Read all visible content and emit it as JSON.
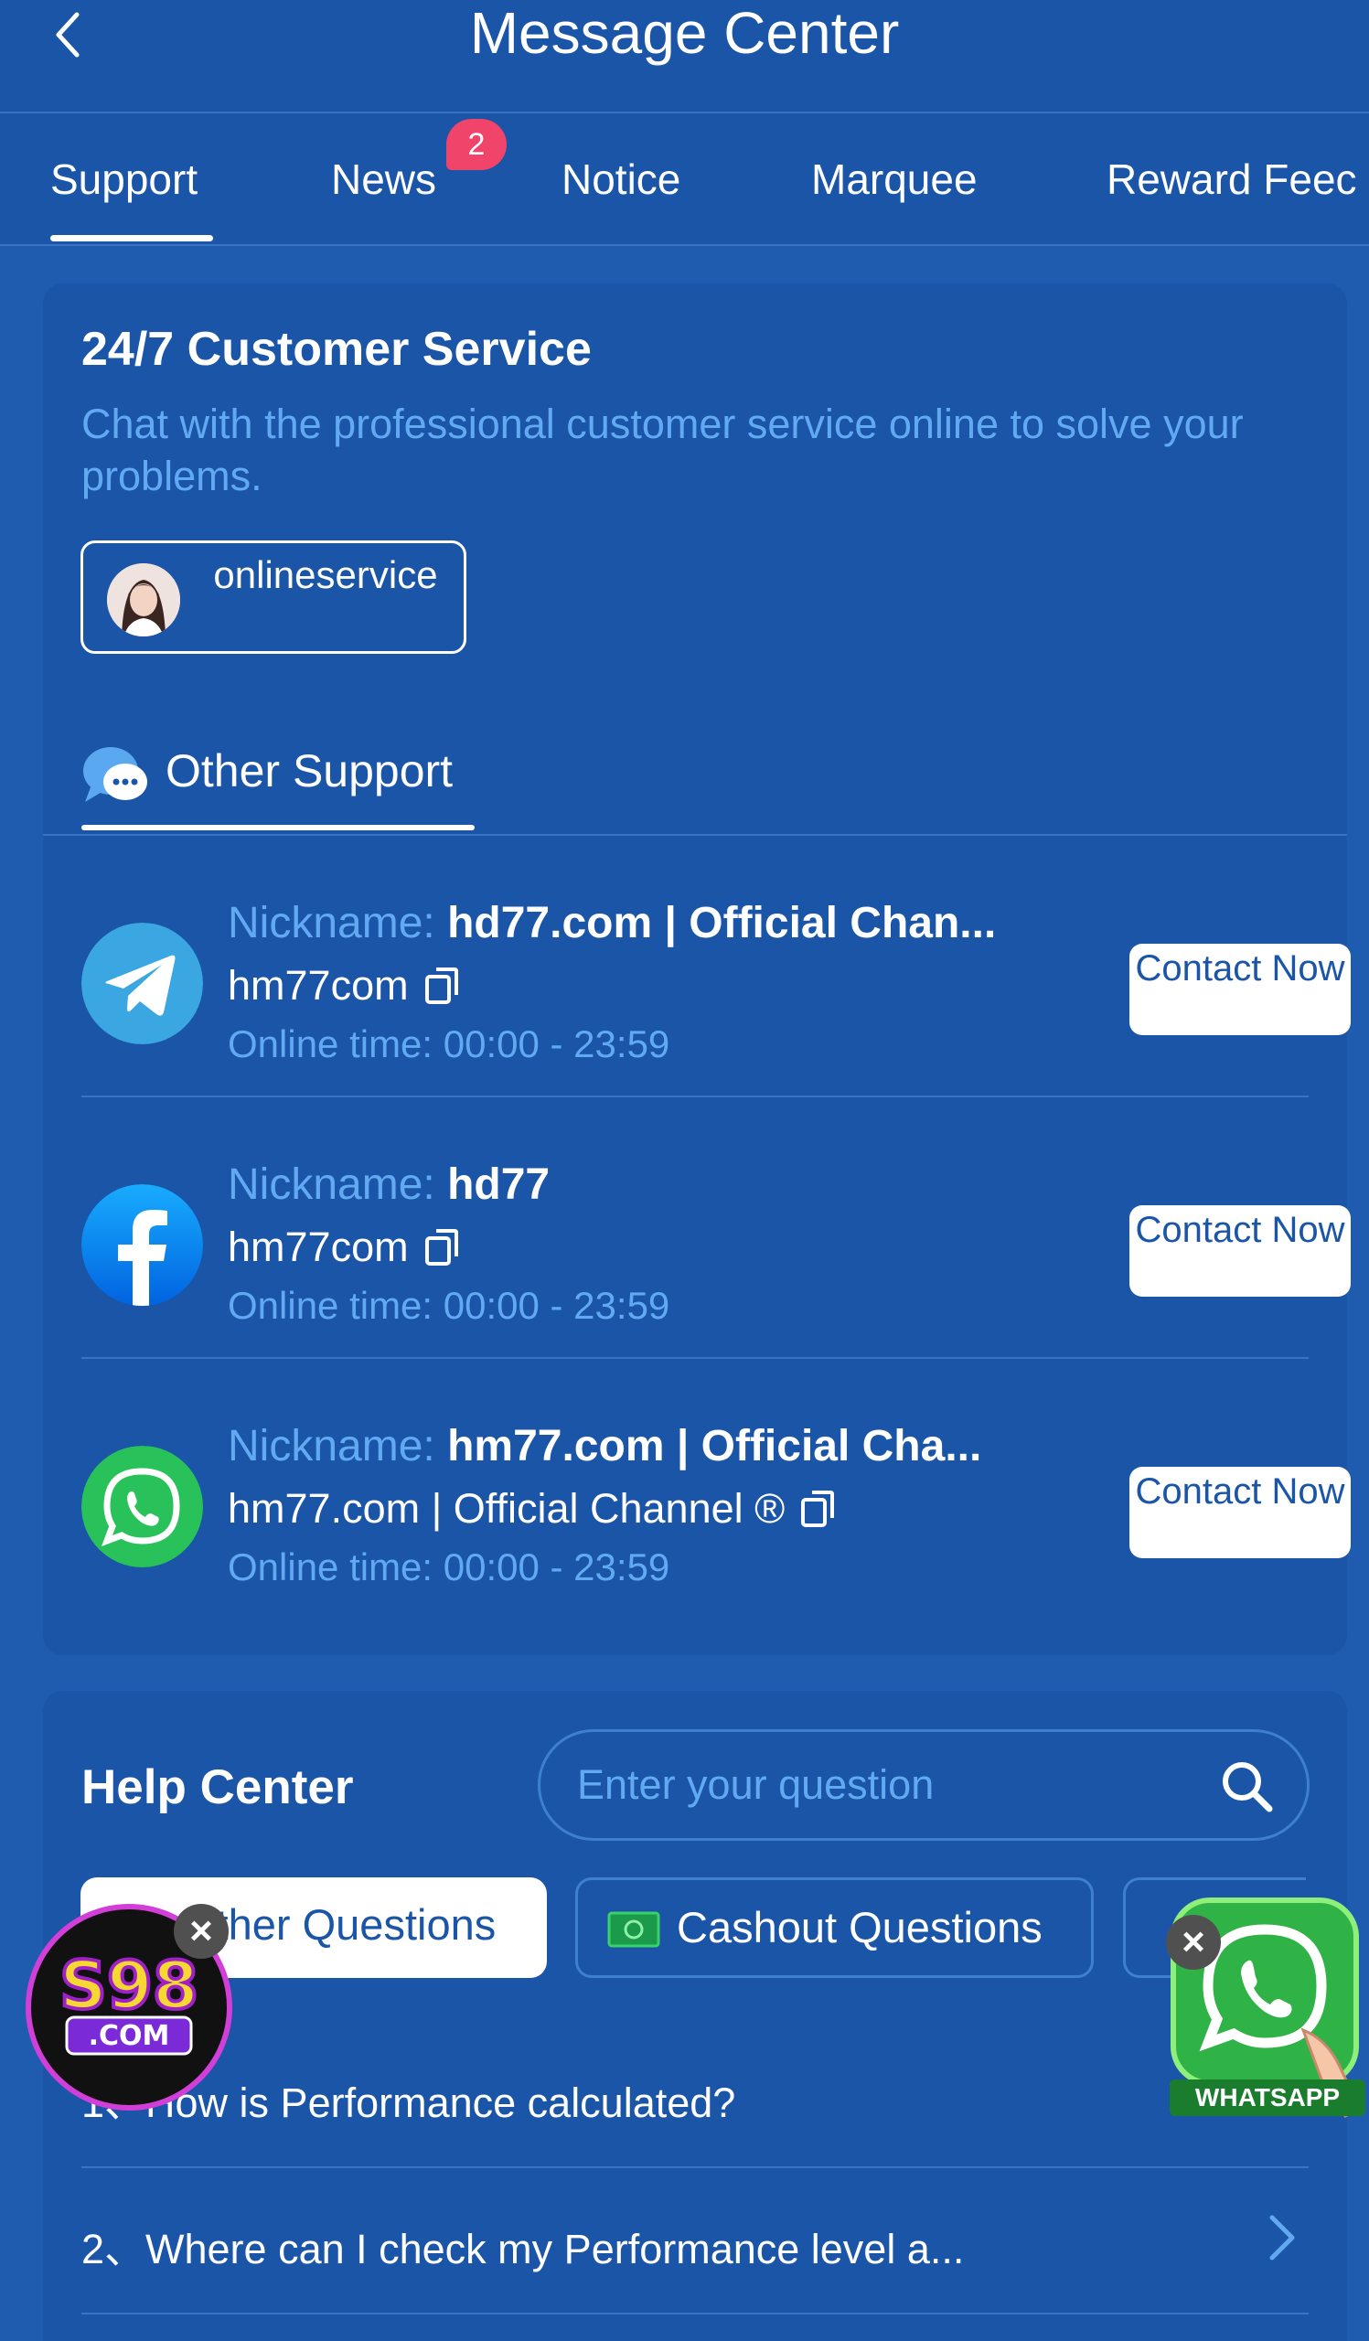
{
  "header": {
    "title": "Message Center"
  },
  "tabs": [
    {
      "label": "Support"
    },
    {
      "label": "News",
      "badge": "2"
    },
    {
      "label": "Notice"
    },
    {
      "label": "Marquee"
    },
    {
      "label": "Reward Feec"
    }
  ],
  "support": {
    "title": "24/7 Customer Service",
    "description": "Chat with the professional customer service online to solve your problems.",
    "online_service_label": "onlineservice",
    "other_support_label": "Other Support",
    "contacts": [
      {
        "platform": "telegram-icon",
        "nickname_label": "Nickname:",
        "nickname": "hd77.com | Official Chan...",
        "account": "hm77com",
        "online_time": "Online time: 00:00 - 23:59",
        "button": "Contact Now"
      },
      {
        "platform": "facebook-icon",
        "nickname_label": "Nickname:",
        "nickname": "hd77",
        "account": "hm77com",
        "online_time": "Online time: 00:00 - 23:59",
        "button": "Contact Now"
      },
      {
        "platform": "whatsapp-icon",
        "nickname_label": "Nickname:",
        "nickname": "hm77.com | Official Cha...",
        "account": "hm77.com | Official Channel ®",
        "online_time": "Online time: 00:00 - 23:59",
        "button": "Contact Now"
      }
    ]
  },
  "help_center": {
    "title": "Help Center",
    "search_placeholder": "Enter your question",
    "categories": [
      {
        "label": "Other Questions"
      },
      {
        "label": "Cashout Questions"
      }
    ],
    "faq": [
      {
        "text": "1、How is Performance calculated?"
      },
      {
        "text": "2、Where can I check my Performance level a..."
      }
    ]
  },
  "floating": {
    "s98_logo": "S98 .COM",
    "whatsapp_label": "WHATSAPP"
  },
  "colors": {
    "background": "#1f5cb0",
    "card": "#1a55a8",
    "accent_text": "#61aaf2",
    "badge": "#f0446a"
  }
}
